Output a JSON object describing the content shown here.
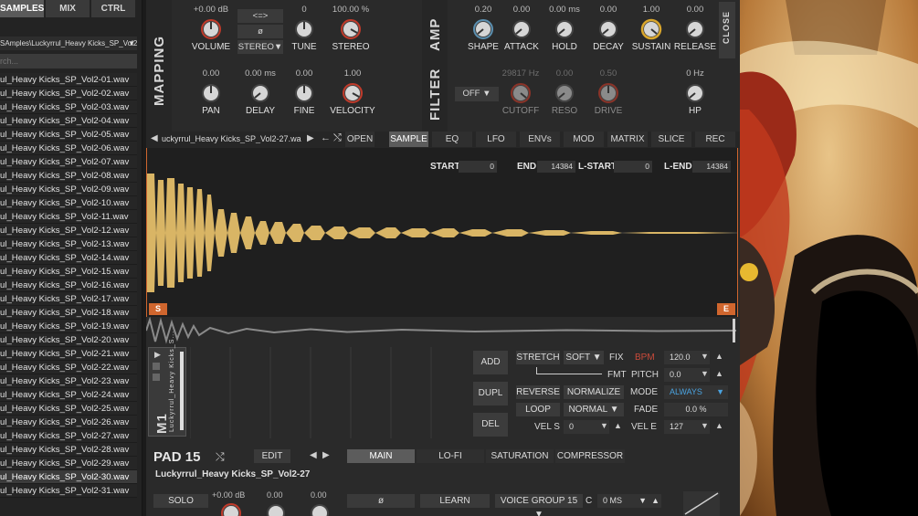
{
  "browser": {
    "tabs": [
      "SAMPLES",
      "MIX",
      "CTRL"
    ],
    "path": "SAmples\\Luckyrrul_Heavy Kicks_SP_Vol2",
    "search_placeholder": "rch...",
    "files": [
      "ul_Heavy Kicks_SP_Vol2-01.wav",
      "ul_Heavy Kicks_SP_Vol2-02.wav",
      "ul_Heavy Kicks_SP_Vol2-03.wav",
      "ul_Heavy Kicks_SP_Vol2-04.wav",
      "ul_Heavy Kicks_SP_Vol2-05.wav",
      "ul_Heavy Kicks_SP_Vol2-06.wav",
      "ul_Heavy Kicks_SP_Vol2-07.wav",
      "ul_Heavy Kicks_SP_Vol2-08.wav",
      "ul_Heavy Kicks_SP_Vol2-09.wav",
      "ul_Heavy Kicks_SP_Vol2-10.wav",
      "ul_Heavy Kicks_SP_Vol2-11.wav",
      "ul_Heavy Kicks_SP_Vol2-12.wav",
      "ul_Heavy Kicks_SP_Vol2-13.wav",
      "ul_Heavy Kicks_SP_Vol2-14.wav",
      "ul_Heavy Kicks_SP_Vol2-15.wav",
      "ul_Heavy Kicks_SP_Vol2-16.wav",
      "ul_Heavy Kicks_SP_Vol2-17.wav",
      "ul_Heavy Kicks_SP_Vol2-18.wav",
      "ul_Heavy Kicks_SP_Vol2-19.wav",
      "ul_Heavy Kicks_SP_Vol2-20.wav",
      "ul_Heavy Kicks_SP_Vol2-21.wav",
      "ul_Heavy Kicks_SP_Vol2-22.wav",
      "ul_Heavy Kicks_SP_Vol2-23.wav",
      "ul_Heavy Kicks_SP_Vol2-24.wav",
      "ul_Heavy Kicks_SP_Vol2-25.wav",
      "ul_Heavy Kicks_SP_Vol2-26.wav",
      "ul_Heavy Kicks_SP_Vol2-27.wav",
      "ul_Heavy Kicks_SP_Vol2-28.wav",
      "ul_Heavy Kicks_SP_Vol2-29.wav",
      "ul_Heavy Kicks_SP_Vol2-30.wav",
      "ul_Heavy Kicks_SP_Vol2-31.wav"
    ],
    "selected_index": 29
  },
  "mapping": {
    "title": "MAPPING",
    "volume": {
      "value": "+0.00 dB",
      "label": "VOLUME"
    },
    "link_btn": "<=>",
    "phase_btn": "ø",
    "stereo_mode": "STEREO",
    "tune": {
      "value": "0",
      "label": "TUNE"
    },
    "stereo": {
      "value": "100.00 %",
      "label": "STEREO"
    },
    "pan": {
      "value": "0.00",
      "label": "PAN"
    },
    "delay": {
      "value": "0.00 ms",
      "label": "DELAY"
    },
    "fine": {
      "value": "0.00",
      "label": "FINE"
    },
    "velocity": {
      "value": "1.00",
      "label": "VELOCITY"
    }
  },
  "amp": {
    "title": "AMP",
    "shape": {
      "value": "0.20",
      "label": "SHAPE"
    },
    "attack": {
      "value": "0.00",
      "label": "ATTACK"
    },
    "hold": {
      "value": "0.00 ms",
      "label": "HOLD"
    },
    "decay": {
      "value": "0.00",
      "label": "DECAY"
    },
    "sustain": {
      "value": "1.00",
      "label": "SUSTAIN"
    },
    "release": {
      "value": "0.00",
      "label": "RELEASE"
    },
    "close": "CLOSE"
  },
  "filter": {
    "title": "FILTER",
    "mode": "OFF",
    "cutoff": {
      "value": "29817 Hz",
      "label": "CUTOFF"
    },
    "reso": {
      "value": "0.00",
      "label": "RESO"
    },
    "drive": {
      "value": "0.50",
      "label": "DRIVE"
    },
    "hp": {
      "value": "0 Hz",
      "label": "HP"
    }
  },
  "sample_bar": {
    "filename": "uckyrrul_Heavy Kicks_SP_Vol2-27.wa",
    "open": "OPEN",
    "tabs": [
      "SAMPLE",
      "EQ",
      "LFO",
      "ENVs",
      "MOD ENV",
      "MATRIX",
      "SLICE",
      "REC"
    ]
  },
  "wave": {
    "start_label": "START",
    "start": "0",
    "end_label": "END",
    "end": "14384",
    "lstart_label": "L-START",
    "lstart": "0",
    "lend_label": "L-END",
    "lend": "14384",
    "s_marker": "S",
    "e_marker": "E"
  },
  "pattern": {
    "pad_label": "M1",
    "clip_name": "Luckyrrul_Heavy Kicks_S...",
    "add": "ADD",
    "dupl": "DUPL",
    "del": "DEL"
  },
  "controls": {
    "stretch": "STRETCH",
    "stretch_mode": "SOFT",
    "fix": "FIX",
    "bpm_label": "BPM",
    "bpm": "120.0",
    "fmt": "FMT",
    "pitch_label": "PITCH",
    "pitch": "0.0",
    "reverse": "REVERSE",
    "normalize": "NORMALIZE",
    "mode_label": "MODE",
    "mode": "ALWAYS",
    "loop": "LOOP",
    "loop_mode": "NORMAL",
    "fade_label": "FADE",
    "fade": "0.0 %",
    "vels_label": "VEL S",
    "vels": "0",
    "vele_label": "VEL E",
    "vele": "127"
  },
  "bottom": {
    "pad_title": "PAD 15",
    "edit": "EDIT",
    "tabs": [
      "MAIN",
      "LO-FI",
      "SATURATION",
      "COMPRESSOR"
    ],
    "sample_name": "Luckyrrul_Heavy Kicks_SP_Vol2-27",
    "solo": "SOLO",
    "k1": "+0.00 dB",
    "k2": "0.00",
    "k3": "0.00",
    "phase": "ø",
    "learn": "LEARN",
    "voice_group": "VOICE GROUP 15",
    "c_label": "C",
    "ms": "0 MS"
  },
  "colors": {
    "accent_orange": "#d0662e",
    "waveform": "#d9b565",
    "knob_red": "#c03a2a",
    "knob_gold": "#d9a62c",
    "knob_blue": "#5a8fb0",
    "bpm_red": "#c94a3a",
    "mode_blue": "#4aa3e0"
  }
}
